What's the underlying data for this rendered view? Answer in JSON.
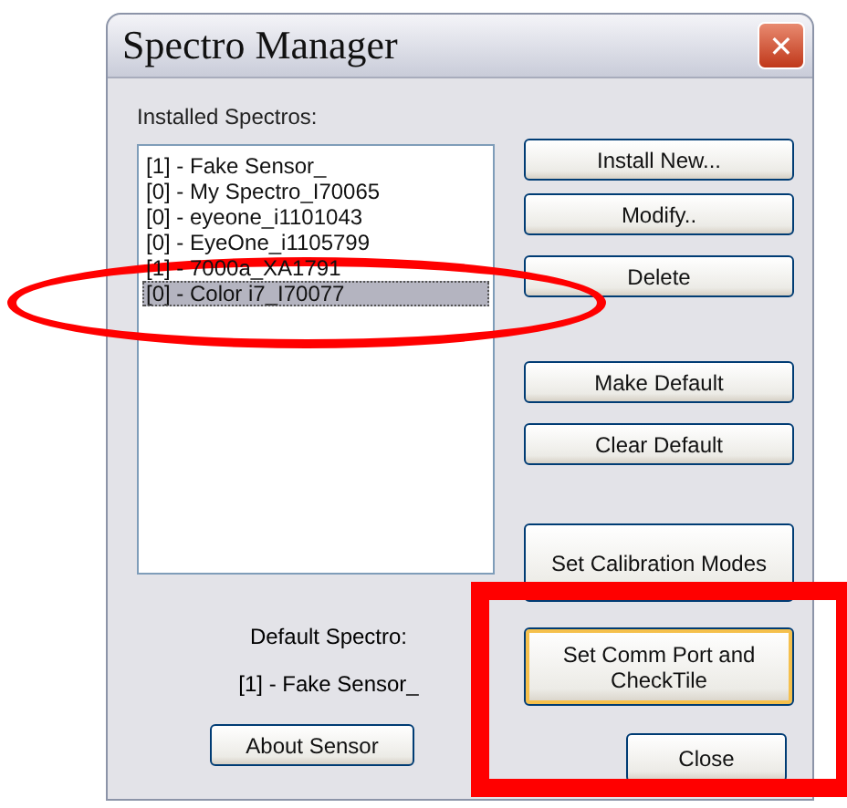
{
  "window": {
    "title": "Spectro Manager",
    "close": "✕"
  },
  "list_label": "Installed Spectros:",
  "spectros": [
    {
      "label": "[1] - Fake Sensor_",
      "selected": false
    },
    {
      "label": "[0] - My Spectro_I70065",
      "selected": false
    },
    {
      "label": "[0] - eyeone_i1101043",
      "selected": false
    },
    {
      "label": "[0] - EyeOne_i1105799",
      "selected": false
    },
    {
      "label": "[1] - 7000a_XA1791",
      "selected": false
    },
    {
      "label": "[0] - Color i7_I70077",
      "selected": true
    }
  ],
  "buttons": [
    {
      "label": "Install New...",
      "focused": false
    },
    {
      "label": "Modify..",
      "focused": false
    },
    {
      "label": "Delete",
      "focused": false
    },
    {
      "label": "Make Default",
      "focused": false
    },
    {
      "label": "Clear Default",
      "focused": false
    },
    {
      "label": "Set Calibration Modes",
      "focused": false
    },
    {
      "label": "Set Comm Port and CheckTile",
      "focused": true
    },
    {
      "label": "Close",
      "focused": false
    }
  ],
  "default_label": "Default Spectro:",
  "default_value": "[1] - Fake Sensor_",
  "about_button": "About Sensor",
  "annotations": [
    {
      "kind": "ellipse"
    },
    {
      "kind": "rectangle"
    }
  ]
}
